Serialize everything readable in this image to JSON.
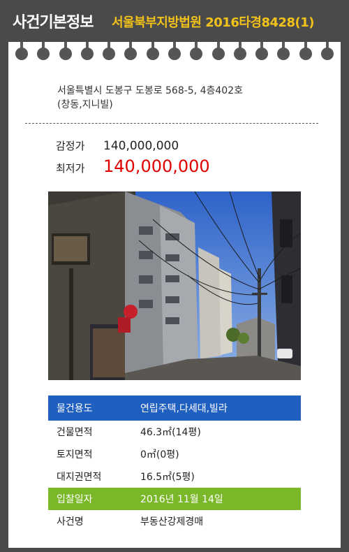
{
  "header": {
    "title": "사건기본정보",
    "court_case": "서울북부지방법원 2016타경8428(1)"
  },
  "address": {
    "line1": "서울특별시 도봉구 도봉로 568-5, 4층402호",
    "line2": "(창동,지니빌)"
  },
  "prices": {
    "appraisal_label": "감정가",
    "appraisal_value": "140,000,000",
    "minimum_label": "최저가",
    "minimum_value": "140,000,000"
  },
  "info": {
    "usage_label": "물건용도",
    "usage_value": "연립주택,다세대,빌라",
    "building_area_label": "건물면적",
    "building_area_value": "46.3㎡(14평)",
    "land_area_label": "토지면적",
    "land_area_value": "0㎡(0평)",
    "land_right_label": "대지권면적",
    "land_right_value": "16.5㎡(5평)",
    "bid_date_label": "입찰일자",
    "bid_date_value": "2016년 11월 14일",
    "case_name_label": "사건명",
    "case_name_value": "부동산강제경매"
  },
  "colors": {
    "header_bg": "#4a4a4a",
    "court_text": "#f3c21a",
    "min_price": "#e00000",
    "usage_bar": "#1f5fc0",
    "bid_bar": "#7ab82a"
  }
}
